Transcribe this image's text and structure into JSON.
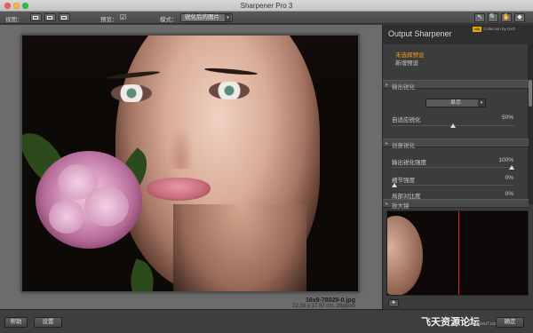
{
  "window": {
    "title": "Sharpener Pro 3"
  },
  "toolbar": {
    "view_label": "视图：",
    "preview_label": "预览：",
    "mode_label": "模式：",
    "mode_value": "锐化后的图片",
    "tools": [
      "↖",
      "🔍",
      "✋",
      "◆"
    ]
  },
  "image": {
    "filename": "16x9-78029-0.jpg",
    "dims": "22.58 x 17.57 cm, 28ppcm"
  },
  "panel": {
    "title": "Output Sharpener",
    "logo_text": "nik",
    "collection_text": "Collection by DxO",
    "preset_selected": "未选择预设",
    "preset_new": "新增预设",
    "section_output": "输出锐化",
    "display_value": "显示",
    "adaptive_label": "自适应锐化",
    "adaptive_value": "50%",
    "adaptive_level": 0.5,
    "section_creative": "创意锐化",
    "output_strength_label": "输出锐化强度",
    "output_strength_value": "100%",
    "output_strength_level": 1.0,
    "detail_label": "细节强度",
    "detail_value": "0%",
    "detail_level": 0.0,
    "local_contrast_label": "局部对比度",
    "local_contrast_value": "0%",
    "local_contrast_level": 0.0,
    "section_loupe": "放大镜"
  },
  "bottom": {
    "help_label": "帮助",
    "settings_label": "设置",
    "watermark": "飞天资源论坛",
    "watermark_url": "feitianwu7.com",
    "ok_label": "确定"
  }
}
